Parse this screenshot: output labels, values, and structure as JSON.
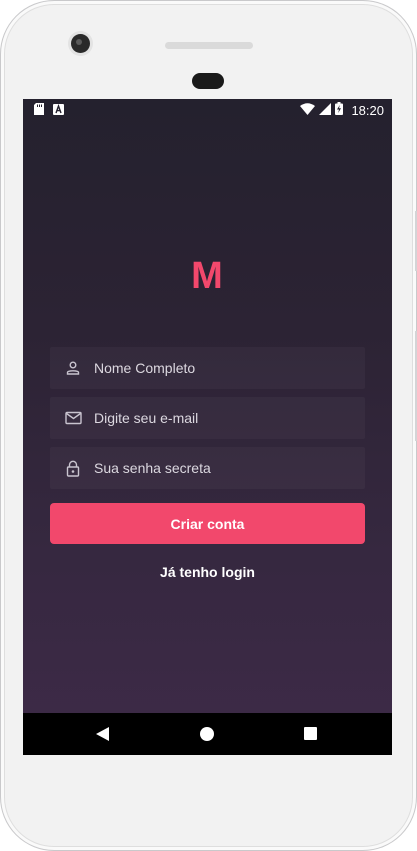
{
  "status_bar": {
    "time": "18:20",
    "left_icons": [
      "sd-card-icon",
      "text-a-icon"
    ],
    "right_icons": [
      "wifi-icon",
      "signal-icon",
      "battery-charging-icon"
    ]
  },
  "app": {
    "logo": "M",
    "accent_color": "#f2486c"
  },
  "form": {
    "name_field": {
      "icon": "person-icon",
      "placeholder": "Nome Completo",
      "value": ""
    },
    "email_field": {
      "icon": "mail-icon",
      "placeholder": "Digite seu e-mail",
      "value": ""
    },
    "password_field": {
      "icon": "lock-icon",
      "placeholder": "Sua senha secreta",
      "value": ""
    },
    "submit_label": "Criar conta",
    "login_link": "Já tenho login"
  },
  "navigation_bar": {
    "buttons": [
      "back-icon",
      "home-icon",
      "recents-icon"
    ]
  }
}
